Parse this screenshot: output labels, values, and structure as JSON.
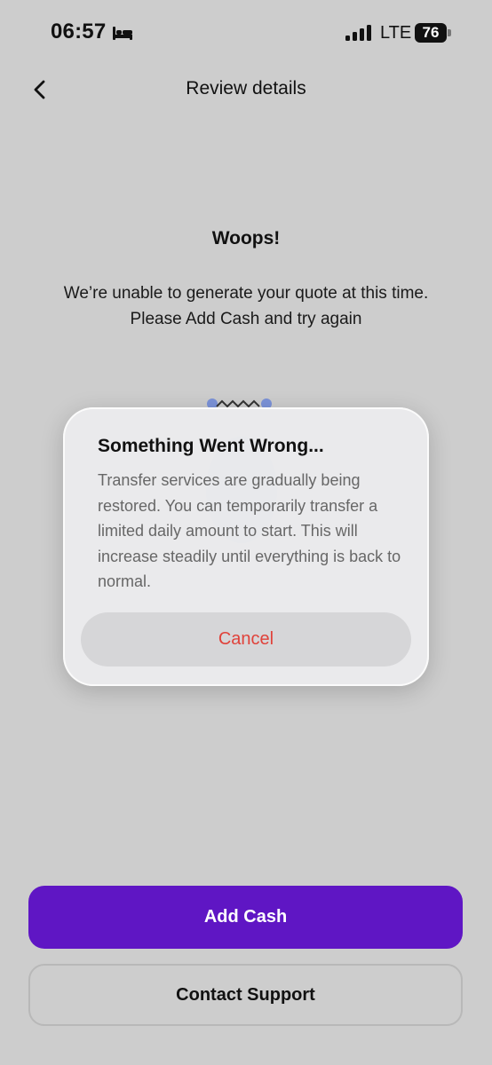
{
  "status_bar": {
    "time": "06:57",
    "network": "LTE",
    "battery": "76",
    "icons": [
      "bed-icon",
      "signal-icon",
      "battery-icon"
    ]
  },
  "header": {
    "title": "Review details",
    "back_icon": "chevron-left-icon"
  },
  "error": {
    "title": "Woops!",
    "message_line1": "We’re unable to generate your quote at this time.",
    "message_line2": "Please Add Cash and try again"
  },
  "dialog": {
    "title": "Something Went Wrong...",
    "message": "Transfer services are gradually being restored. You can temporarily transfer a limited daily amount to start. This will increase steadily until everything is back to normal.",
    "cancel_label": "Cancel"
  },
  "actions": {
    "add_cash_label": "Add Cash",
    "contact_support_label": "Contact Support"
  },
  "colors": {
    "background": "#cdcdcd",
    "primary": "#5f16c4",
    "cancel_text": "#e0423a",
    "dialog_background": "#ececee"
  }
}
